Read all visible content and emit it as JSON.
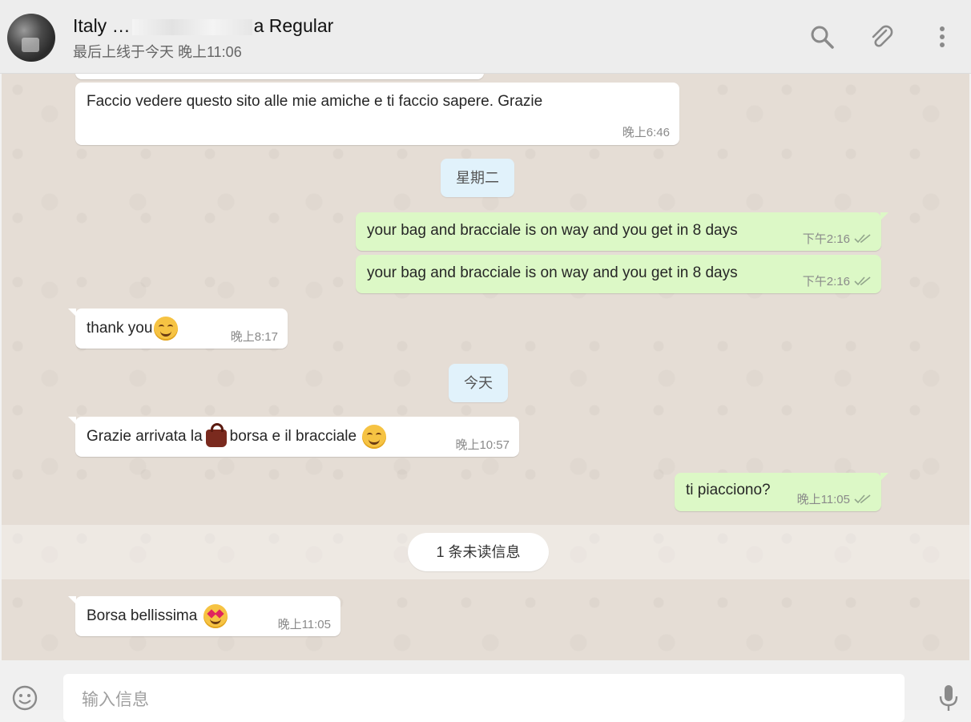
{
  "header": {
    "contact_name_start": "Italy …",
    "contact_name_end": "a Regular",
    "status": "最后上线于今天 晚上11:06",
    "icons": [
      "search-icon",
      "attach-icon",
      "menu-icon"
    ]
  },
  "messages": [
    {
      "text": "Faccio vedere questo sito alle mie amiche e ti faccio sapere. Grazie",
      "time": "晚上6:46"
    },
    {
      "day": "星期二"
    },
    {
      "text": "your bag and bracciale is on way and you get in 8 days",
      "time": "下午2:16"
    },
    {
      "text": "your bag and bracciale is on way and you get in 8 days",
      "time": "下午2:16"
    },
    {
      "text": "thank you",
      "time": "晚上8:17"
    },
    {
      "day": "今天"
    },
    {
      "text_a": "Grazie arrivata la",
      "text_b": "borsa e il bracciale",
      "time": "晚上10:57"
    },
    {
      "text": "ti piacciono?",
      "time": "晚上11:05"
    },
    {
      "unread": "1 条未读信息"
    },
    {
      "text": "Borsa bellissima",
      "time": "晚上11:05"
    }
  ],
  "footer": {
    "placeholder": "输入信息",
    "icons": [
      "emoji-icon",
      "microphone-icon"
    ]
  },
  "colors": {
    "incoming_bubble": "#ffffff",
    "outgoing_bubble": "#dcf8c6",
    "chat_background": "#e5ddd5",
    "tick_read": "#92a58c"
  }
}
